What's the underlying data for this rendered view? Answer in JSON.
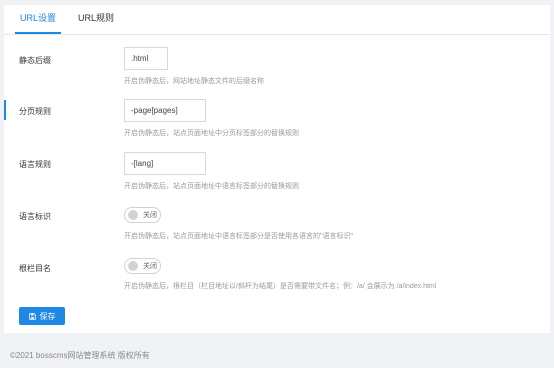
{
  "tabs": [
    {
      "label": "URL设置",
      "active": true
    },
    {
      "label": "URL规则",
      "active": false
    }
  ],
  "fields": {
    "suffix": {
      "label": "静态后缀",
      "value": ".html",
      "hint": "开启伪静态后，网站地址静态文件的后缀名称"
    },
    "page_rule": {
      "label": "分页规则",
      "value": "-page[pages]",
      "hint": "开启伪静态后，站点页面地址中分页标签部分的替换规则"
    },
    "lang_rule": {
      "label": "语言规则",
      "value": "-[lang]",
      "hint": "开启伪静态后，站点页面地址中语言标签部分的替换规则"
    },
    "lang_flag": {
      "label": "语言标识",
      "switch_text": "关闭",
      "enabled": false,
      "hint": "开启伪静态后，站点页面地址中语言标签部分是否使用各语言的\"语言标识\""
    },
    "root_name": {
      "label": "根栏目名",
      "switch_text": "关闭",
      "enabled": false,
      "hint": "开启伪静态后，根栏目（栏目地址以/斜杆为结尾）是否需要带文件名；例：/a/ 会展示为 /a/index.html"
    }
  },
  "save_button": {
    "label": "保存",
    "icon": "save-icon"
  },
  "footer": "©2021 bosscms网站管理系统 版权所有",
  "colors": {
    "accent": "#1e88e5",
    "background": "#f0f2f5"
  }
}
